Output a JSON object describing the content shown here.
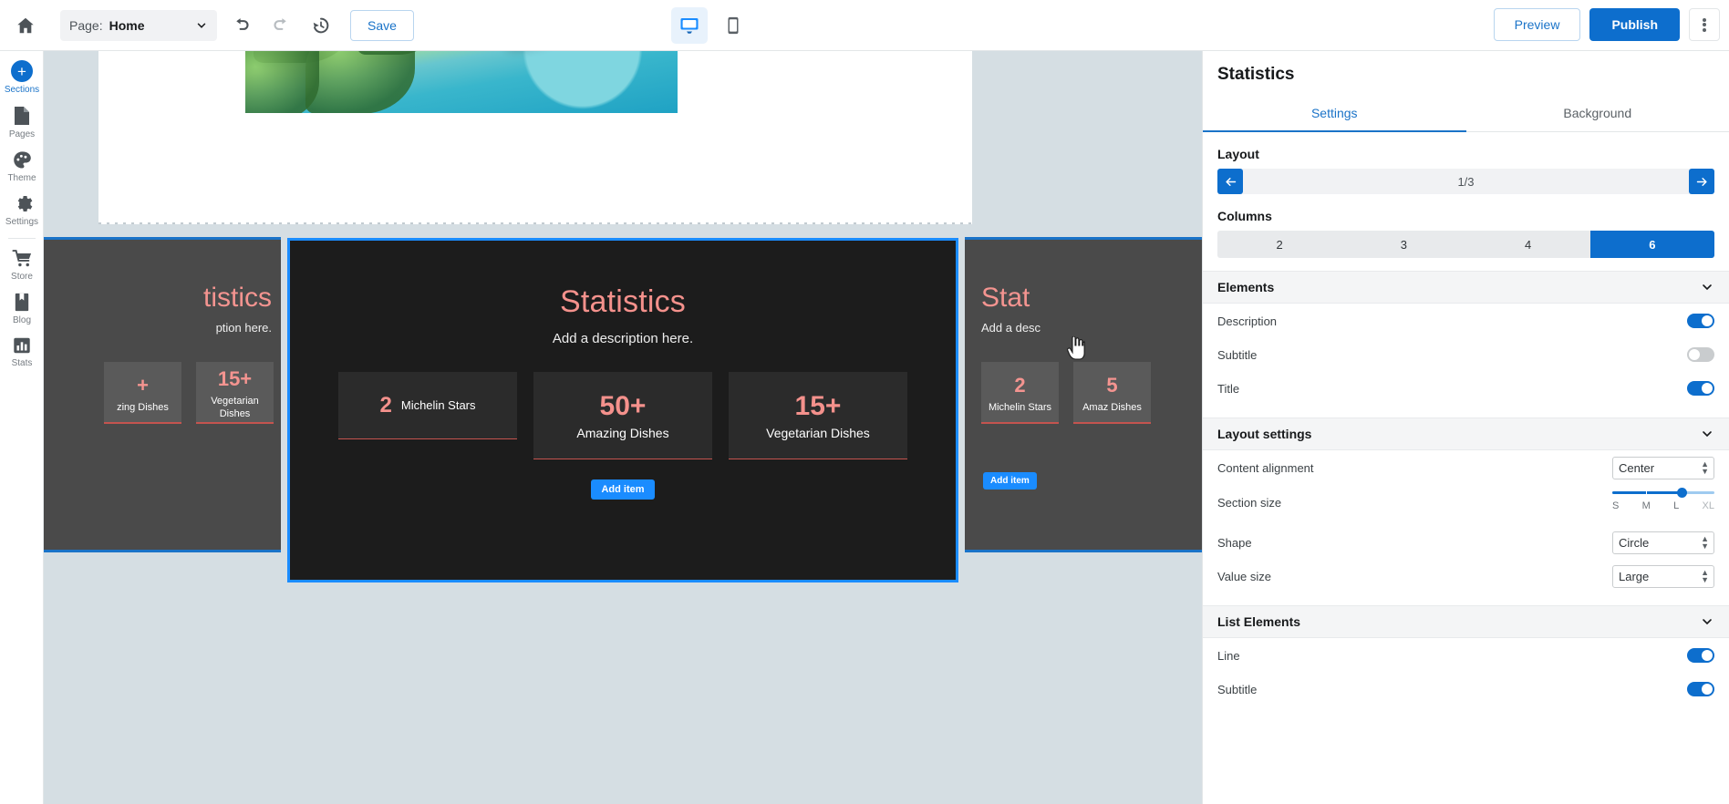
{
  "topbar": {
    "home_icon": "home-icon",
    "page_label": "Page:",
    "page_value": "Home",
    "undo_icon": "undo-icon",
    "redo_icon": "redo-icon",
    "history_icon": "history-icon",
    "save_label": "Save",
    "device_desktop": "desktop-icon",
    "device_mobile": "mobile-icon",
    "preview_label": "Preview",
    "publish_label": "Publish",
    "more_icon": "kebab-menu-icon"
  },
  "sidebar": {
    "items": [
      {
        "label": "Sections",
        "icon": "plus-circle-icon",
        "active": true
      },
      {
        "label": "Pages",
        "icon": "page-icon",
        "active": false
      },
      {
        "label": "Theme",
        "icon": "palette-icon",
        "active": false
      },
      {
        "label": "Settings",
        "icon": "gear-icon",
        "active": false
      },
      {
        "label": "Store",
        "icon": "cart-icon",
        "active": false
      },
      {
        "label": "Blog",
        "icon": "book-icon",
        "active": false
      },
      {
        "label": "Stats",
        "icon": "bar-chart-icon",
        "active": false
      }
    ]
  },
  "canvas": {
    "selected_section": {
      "title": "Statistics",
      "description": "Add a description here.",
      "add_item_label": "Add item",
      "stats": [
        {
          "value": "2",
          "label": "Michelin Stars",
          "layout": "inline"
        },
        {
          "value": "50+",
          "label": "Amazing Dishes",
          "layout": "stacked"
        },
        {
          "value": "15+",
          "label": "Vegetarian Dishes",
          "layout": "stacked"
        }
      ]
    },
    "dim_left_section": {
      "title": "tistics",
      "description": "ption here.",
      "stats": [
        {
          "value": "+",
          "label": "zing Dishes"
        },
        {
          "value": "15+",
          "label": "Vegetarian Dishes"
        }
      ]
    },
    "dim_right_section": {
      "title": "Stat",
      "description": "Add a desc",
      "add_item_label": "Add item",
      "stats": [
        {
          "value": "2",
          "label": "Michelin Stars"
        },
        {
          "value": "5",
          "label": "Amaz Dishes"
        }
      ]
    }
  },
  "panel": {
    "title": "Statistics",
    "tabs": [
      {
        "label": "Settings",
        "active": true
      },
      {
        "label": "Background",
        "active": false
      }
    ],
    "layout": {
      "heading": "Layout",
      "prev_icon": "arrow-left-icon",
      "next_icon": "arrow-right-icon",
      "counter": "1/3"
    },
    "columns": {
      "heading": "Columns",
      "options": [
        "2",
        "3",
        "4",
        "6"
      ],
      "selected": "6"
    },
    "elements": {
      "heading": "Elements",
      "collapse_icon": "chevron-down-icon",
      "rows": [
        {
          "label": "Description",
          "on": true
        },
        {
          "label": "Subtitle",
          "on": false
        },
        {
          "label": "Title",
          "on": true
        }
      ]
    },
    "layout_settings": {
      "heading": "Layout settings",
      "collapse_icon": "chevron-down-icon",
      "content_alignment": {
        "label": "Content alignment",
        "value": "Center"
      },
      "section_size": {
        "label": "Section size",
        "marks": [
          "S",
          "M",
          "L",
          "XL"
        ],
        "selected": "L"
      },
      "shape": {
        "label": "Shape",
        "value": "Circle"
      },
      "value_size": {
        "label": "Value size",
        "value": "Large"
      }
    },
    "list_elements": {
      "heading": "List Elements",
      "collapse_icon": "chevron-down-icon",
      "rows": [
        {
          "label": "Line",
          "on": true
        },
        {
          "label": "Subtitle",
          "on": true
        }
      ]
    }
  }
}
